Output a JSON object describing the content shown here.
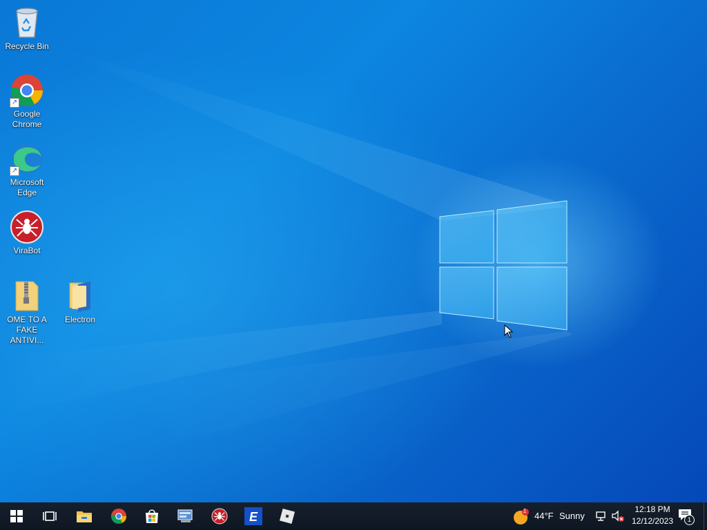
{
  "desktop": {
    "icons": [
      {
        "name": "recycle-bin",
        "label": "Recycle Bin",
        "icon": "recycle-bin-icon"
      },
      {
        "name": "google-chrome",
        "label": "Google Chrome",
        "icon": "chrome-icon"
      },
      {
        "name": "microsoft-edge",
        "label": "Microsoft Edge",
        "icon": "edge-icon"
      },
      {
        "name": "virabot",
        "label": "ViraBot",
        "icon": "virabot-icon"
      },
      {
        "name": "zip-folder",
        "label": "OME TO A FAKE ANTIVI...",
        "icon": "zip-folder-icon"
      },
      {
        "name": "electron-folder",
        "label": "Electron",
        "icon": "folder-icon"
      }
    ]
  },
  "taskbar": {
    "start": "start-icon",
    "apps": [
      "task-view-icon",
      "file-explorer-icon",
      "chrome-icon",
      "microsoft-store-icon",
      "control-panel-icon",
      "virabot-icon",
      "e-app-icon",
      "roblox-icon"
    ],
    "weather": {
      "temperature": "44°F",
      "condition": "Sunny",
      "badge": "1"
    },
    "clock": {
      "time": "12:18 PM",
      "date": "12/12/2023"
    },
    "notifications": {
      "count": "1"
    }
  },
  "colors": {
    "taskbar": "#0e1622",
    "desktop_accent": "#0a78d6"
  }
}
